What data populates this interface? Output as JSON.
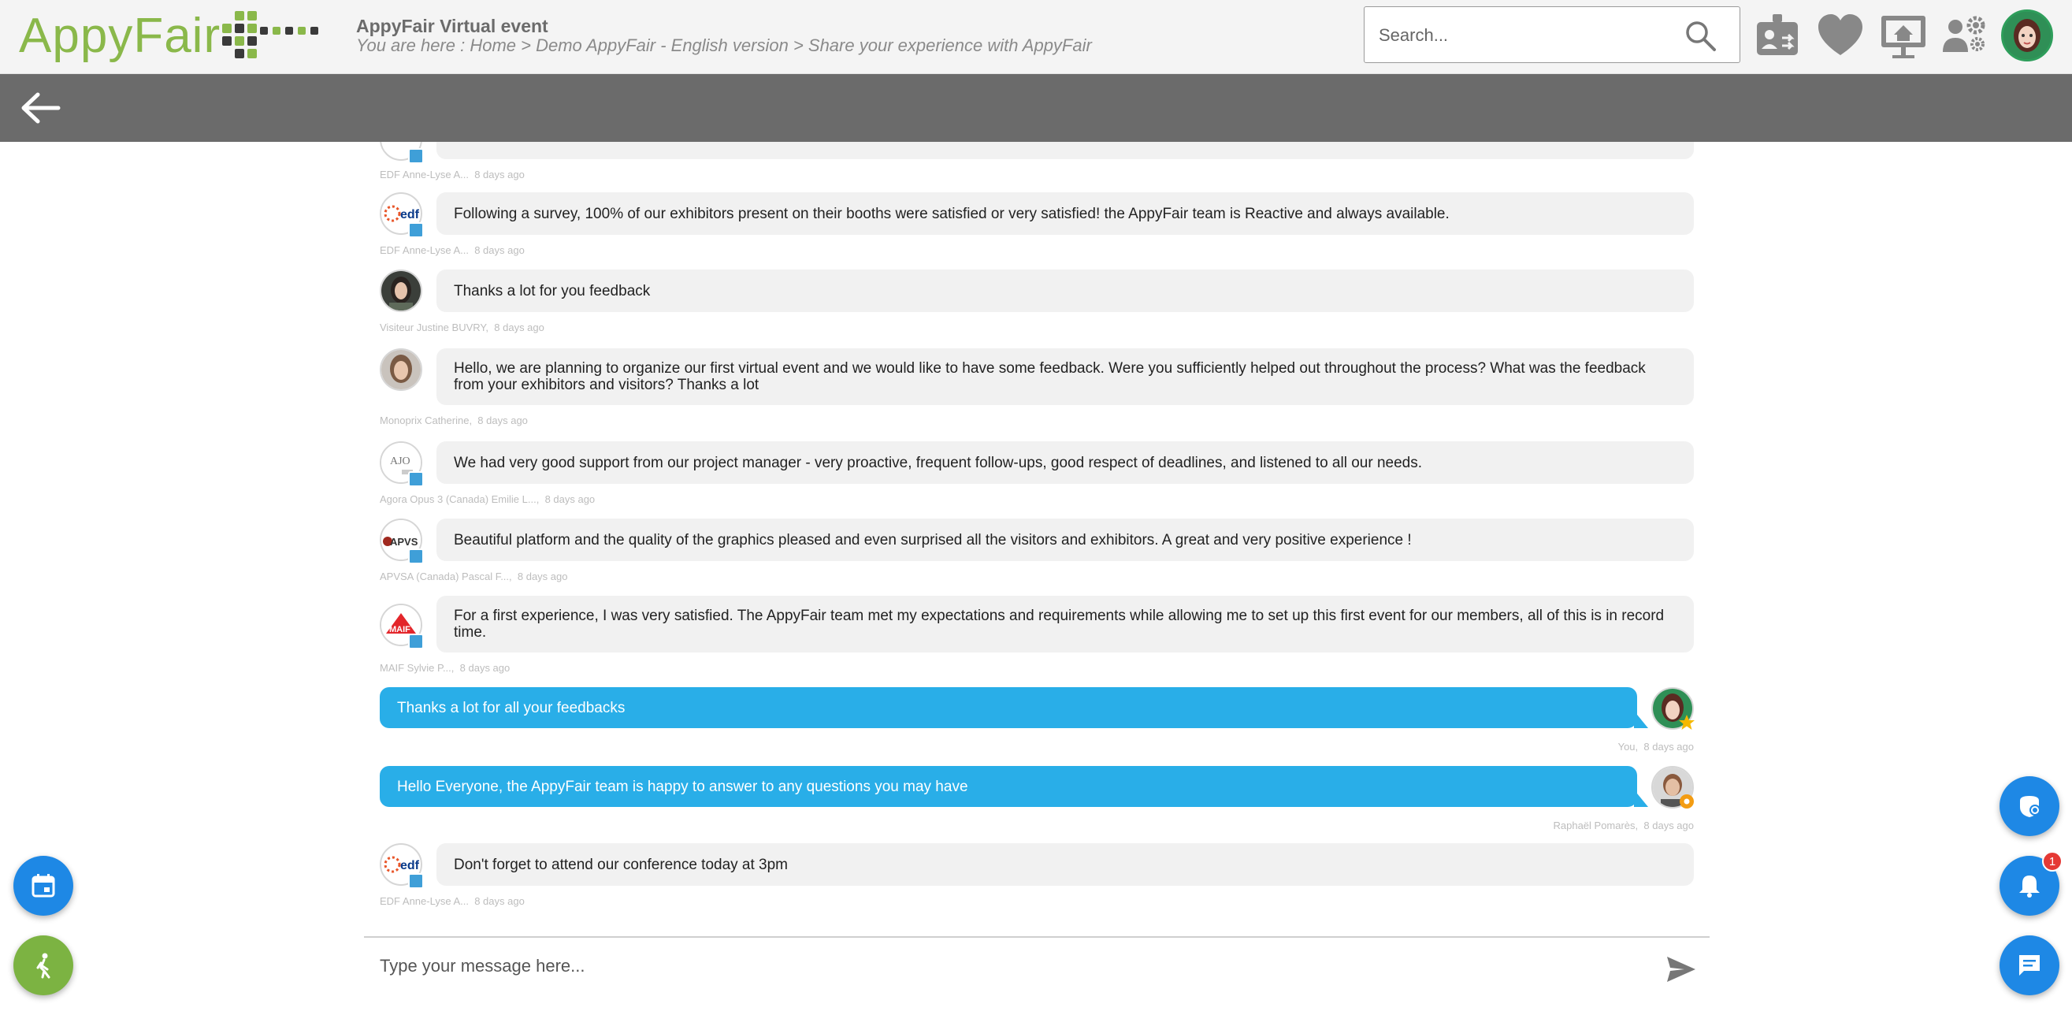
{
  "header": {
    "logo_text": "AppyFair",
    "event_title": "AppyFair Virtual event",
    "breadcrumb": "You are here : Home > Demo AppyFair - English version > Share your experience with AppyFair",
    "search_placeholder": "Search...",
    "icons": [
      "badge-icon",
      "heart-icon",
      "stand-icon",
      "exhibitors-settings-icon",
      "user-avatar"
    ]
  },
  "colors": {
    "topbar_bg": "#f4f4f4",
    "subbar_bg": "#6b6b6b",
    "logo_green": "#8ab84a",
    "bubble_grey": "#f1f1f1",
    "bubble_mine": "#29aee8",
    "fab_blue": "#1e88e5",
    "fab_green": "#7cb342",
    "notif_red": "#e53935"
  },
  "messages": [
    {
      "text": "",
      "author": "EDF Anne-Lyse A...",
      "time": "8 days ago",
      "mine": false,
      "avatar": "edf-logo"
    },
    {
      "text": "Following a survey, 100% of our exhibitors present on their booths were satisfied or very satisfied! the AppyFair team is Reactive and always available.",
      "author": "EDF Anne-Lyse A...",
      "time": "8 days ago",
      "mine": false,
      "avatar": "edf-logo"
    },
    {
      "text": "Thanks a lot for you feedback",
      "author": "Visiteur Justine BUVRY,",
      "time": "8 days ago",
      "mine": false,
      "avatar": "photo"
    },
    {
      "text": "Hello, we are planning to organize our first virtual event and we would like to have some feedback. Were you sufficiently helped out throughout the process? What was the feedback from your exhibitors and visitors? Thanks a lot",
      "author": "Monoprix Catherine,",
      "time": "8 days ago",
      "mine": false,
      "avatar": "photo"
    },
    {
      "text": "We had very good support from our project manager - very proactive, frequent follow-ups, good respect of deadlines,  and listened to all our needs.",
      "author": "Agora Opus 3 (Canada) Emilie L...,",
      "time": "8 days ago",
      "mine": false,
      "avatar": "ajo-logo"
    },
    {
      "text": "Beautiful platform and the quality of the graphics pleased and even surprised all the visitors and exhibitors. A great and very positive experience !",
      "author": "APVSA (Canada) Pascal F...,",
      "time": "8 days ago",
      "mine": false,
      "avatar": "apvs-logo"
    },
    {
      "text": "For a first experience, I was very satisfied. The AppyFair team met my expectations and requirements while allowing me to set up this first event for our members, all of this is in record time.",
      "author": "MAIF Sylvie P...,",
      "time": "8 days ago",
      "mine": false,
      "avatar": "maif-logo"
    },
    {
      "text": "Thanks a lot for all your feedbacks",
      "author": "You,",
      "time": "8 days ago",
      "mine": true,
      "avatar": "photo"
    },
    {
      "text": "Hello Everyone, the AppyFair team is happy to answer to any questions you may have",
      "author": "Raphaël Pomarès,",
      "time": "8 days ago",
      "mine": true,
      "avatar": "photo"
    },
    {
      "text": "Don't forget to attend our conference today at 3pm",
      "author": "EDF Anne-Lyse A...",
      "time": "8 days ago",
      "mine": false,
      "avatar": "edf-logo"
    }
  ],
  "composer": {
    "placeholder": "Type your message here..."
  },
  "fabs": {
    "notification_count": "1"
  },
  "avatar_labels": {
    "edf": "edf",
    "ajo": "AJO",
    "apvs": "APVS",
    "maif": "MAIF"
  }
}
